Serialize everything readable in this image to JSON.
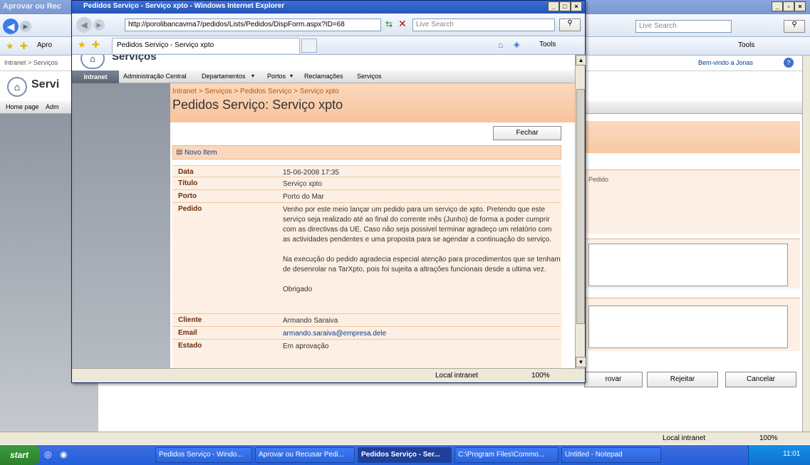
{
  "back_window": {
    "title": "Aprovar ou Rec",
    "search_placeholder": "Live Search",
    "tab_label": "Apro",
    "tools_label": "Tools",
    "welcome": "Bem-vindo a Jonas",
    "breadcrumb": "Intranet > Serviços",
    "site_title": "Servi",
    "nav": [
      "Home page",
      "Adm"
    ],
    "pedido_label": "Pedido",
    "buttons": [
      "rovar",
      "Rejeitar",
      "Cancelar"
    ],
    "status_zone": "Local intranet",
    "zoom": "100%"
  },
  "front_window": {
    "title": "Pedidos Serviço - Serviço xpto - Windows Internet Explorer",
    "url": "http://porolibancavma7/pedidos/Lists/Pedidos/DispForm.aspx?ID=68",
    "search_placeholder": "Live Search",
    "tab_label": "Pedidos Serviço - Serviço xpto",
    "tools_label": "Tools",
    "site_title_partial": "Serviços",
    "topnav": [
      "Intranet",
      "Administração Central",
      "Departamentos",
      "Portos",
      "Reclamações",
      "Serviços"
    ],
    "breadcrumb": "Intranet > Serviços > Pedidos Serviço > Serviço xpto",
    "page_title": "Pedidos Serviço: Serviço xpto",
    "close_button": "Fechar",
    "new_item": "Novo Item",
    "fields": [
      {
        "label": "Data",
        "value": "15-06-2008 17:35"
      },
      {
        "label": "Título",
        "value": "Serviço xpto"
      },
      {
        "label": "Porto",
        "value": "Porto do Mar"
      },
      {
        "label": "Pedido",
        "value": "Venho por este meio lançar um pedido para um serviço de xpto. Pretendo que este serviço seja realizado até ao final do corrente mês (Junho) de forma a poder cumprir com as directivas da UE. Caso não seja possivel terminar agradeço um relatório com as actividades pendentes e uma proposta para se agendar a continuação do serviço.\n\nNa execução do pedido agradecia especial atenção para procedimentos que se tenham de desenrolar na TarXpto, pois foi sujeita a altrações funcionais desde a ultima vez.\n\nObrigado"
      },
      {
        "label": "Cliente",
        "value": "Armando Saraiva"
      },
      {
        "label": "Email",
        "value": "armando.saraiva@empresa.dele"
      },
      {
        "label": "Estado",
        "value": "Em aprovação"
      }
    ],
    "status_zone": "Local intranet",
    "zoom": "100%"
  },
  "taskbar": {
    "start": "start",
    "items": [
      "Pedidos Serviço - Windo...",
      "Aprovar ou Recusar Pedi...",
      "Pedidos Serviço - Ser...",
      "C:\\Program Files\\Commo...",
      "Untitled - Notepad"
    ],
    "clock": "11:01"
  }
}
